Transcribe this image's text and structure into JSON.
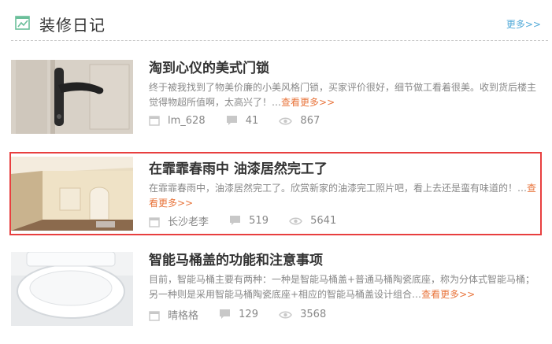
{
  "section": {
    "title": "装修日记",
    "more_label": "更多>>"
  },
  "colors": {
    "accent_red": "#e83f3f",
    "link_orange": "#e8743b",
    "more_blue": "#52aad8",
    "icon_green": "#6bbf9a"
  },
  "articles": [
    {
      "title": "淘到心仪的美式门锁",
      "summary": "终于被我找到了物美价廉的小美风格门锁，买家评价很好，细节做工看着很美。收到货后楼主觉得物超所值啊，太高兴了！…",
      "readmore": "查看更多>>",
      "author": "lm_628",
      "comments": "41",
      "views": "867",
      "thumb_icon": "door-handle-photo",
      "highlighted": false
    },
    {
      "title": "在霏霏春雨中 油漆居然完工了",
      "summary": "在霏霏春雨中，油漆居然完工了。欣赏新家的油漆完工照片吧，看上去还是蛮有味道的！…",
      "readmore": "查看更多>>",
      "author": "长沙老李",
      "comments": "519",
      "views": "5641",
      "thumb_icon": "painted-room-photo",
      "highlighted": true
    },
    {
      "title": "智能马桶盖的功能和注意事项",
      "summary": "目前，智能马桶主要有两种：一种是智能马桶盖+普通马桶陶瓷底座，称为分体式智能马桶；另一种则是采用智能马桶陶瓷底座+相应的智能马桶盖设计组合…",
      "readmore": "查看更多>>",
      "author": "晴格格",
      "comments": "129",
      "views": "3568",
      "thumb_icon": "toilet-photo",
      "highlighted": false
    }
  ]
}
